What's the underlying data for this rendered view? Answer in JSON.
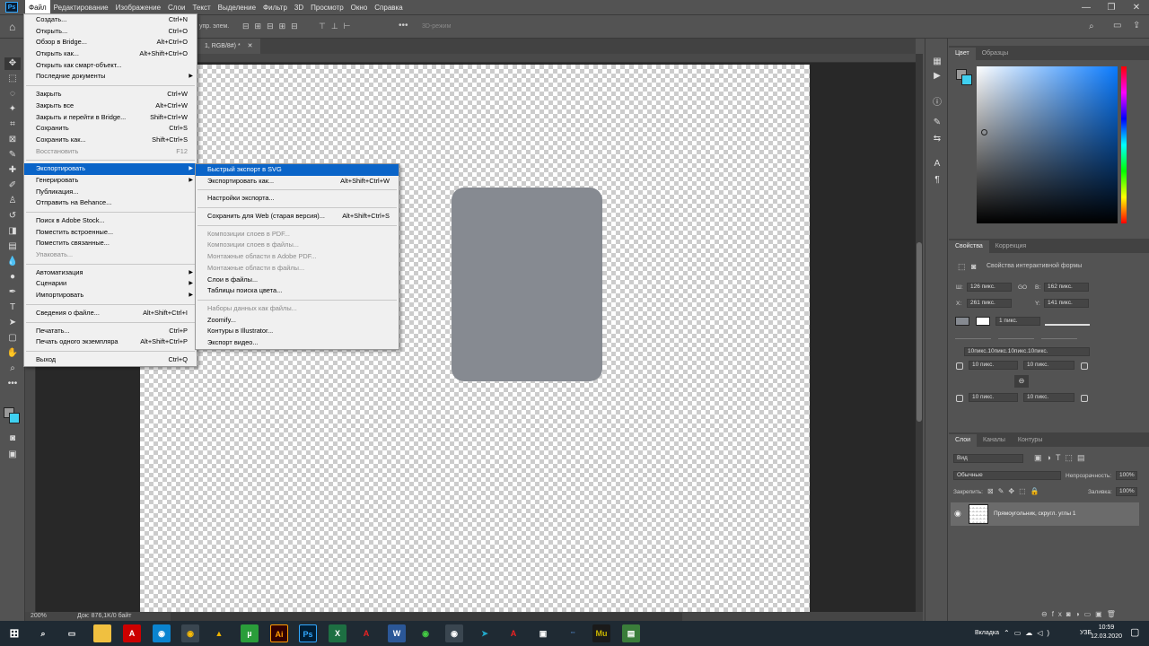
{
  "menubar": {
    "app_icon": "Ps",
    "items": [
      "Файл",
      "Редактирование",
      "Изображение",
      "Слои",
      "Текст",
      "Выделение",
      "Фильтр",
      "3D",
      "Просмотр",
      "Окно",
      "Справка"
    ]
  },
  "options": {
    "label": "упр. элем.",
    "mode3d": "3D-режим"
  },
  "document": {
    "tab_label": "1, RGB/8#) *",
    "zoom": "200%",
    "doc_info": "Док: 876,1K/0 байт"
  },
  "file_menu": {
    "groups": [
      [
        {
          "label": "Создать...",
          "shortcut": "Ctrl+N"
        },
        {
          "label": "Открыть...",
          "shortcut": "Ctrl+O"
        },
        {
          "label": "Обзор в Bridge...",
          "shortcut": "Alt+Ctrl+O"
        },
        {
          "label": "Открыть как...",
          "shortcut": "Alt+Shift+Ctrl+O"
        },
        {
          "label": "Открыть как смарт-объект...",
          "shortcut": ""
        },
        {
          "label": "Последние документы",
          "shortcut": "",
          "submenu": true
        }
      ],
      [
        {
          "label": "Закрыть",
          "shortcut": "Ctrl+W"
        },
        {
          "label": "Закрыть все",
          "shortcut": "Alt+Ctrl+W"
        },
        {
          "label": "Закрыть и перейти в Bridge...",
          "shortcut": "Shift+Ctrl+W"
        },
        {
          "label": "Сохранить",
          "shortcut": "Ctrl+S"
        },
        {
          "label": "Сохранить как...",
          "shortcut": "Shift+Ctrl+S"
        },
        {
          "label": "Восстановить",
          "shortcut": "F12",
          "disabled": true
        }
      ],
      [
        {
          "label": "Экспортировать",
          "shortcut": "",
          "submenu": true,
          "highlight": true
        },
        {
          "label": "Генерировать",
          "shortcut": "",
          "submenu": true
        },
        {
          "label": "Публикация...",
          "shortcut": ""
        },
        {
          "label": "Отправить на Behance...",
          "shortcut": ""
        }
      ],
      [
        {
          "label": "Поиск в Adobe Stock...",
          "shortcut": ""
        },
        {
          "label": "Поместить встроенные...",
          "shortcut": ""
        },
        {
          "label": "Поместить связанные...",
          "shortcut": ""
        },
        {
          "label": "Упаковать...",
          "shortcut": "",
          "disabled": true
        }
      ],
      [
        {
          "label": "Автоматизация",
          "shortcut": "",
          "submenu": true
        },
        {
          "label": "Сценарии",
          "shortcut": "",
          "submenu": true
        },
        {
          "label": "Импортировать",
          "shortcut": "",
          "submenu": true
        }
      ],
      [
        {
          "label": "Сведения о файле...",
          "shortcut": "Alt+Shift+Ctrl+I"
        }
      ],
      [
        {
          "label": "Печатать...",
          "shortcut": "Ctrl+P"
        },
        {
          "label": "Печать одного экземпляра",
          "shortcut": "Alt+Shift+Ctrl+P"
        }
      ],
      [
        {
          "label": "Выход",
          "shortcut": "Ctrl+Q"
        }
      ]
    ]
  },
  "export_menu": {
    "groups": [
      [
        {
          "label": "Быстрый экспорт в SVG",
          "shortcut": "",
          "highlight": true
        },
        {
          "label": "Экспортировать как...",
          "shortcut": "Alt+Shift+Ctrl+W"
        }
      ],
      [
        {
          "label": "Настройки экспорта...",
          "shortcut": ""
        }
      ],
      [
        {
          "label": "Сохранить для Web (старая версия)...",
          "shortcut": "Alt+Shift+Ctrl+S"
        }
      ],
      [
        {
          "label": "Композиции слоев в PDF...",
          "shortcut": "",
          "disabled": true
        },
        {
          "label": "Композиции слоев в файлы...",
          "shortcut": "",
          "disabled": true
        },
        {
          "label": "Монтажные области в Adobe PDF...",
          "shortcut": "",
          "disabled": true
        },
        {
          "label": "Монтажные области в файлы...",
          "shortcut": "",
          "disabled": true
        },
        {
          "label": "Слои в файлы...",
          "shortcut": ""
        },
        {
          "label": "Таблицы поиска цвета...",
          "shortcut": ""
        }
      ],
      [
        {
          "label": "Наборы данных как файлы...",
          "shortcut": "",
          "disabled": true
        },
        {
          "label": "Zoomify...",
          "shortcut": ""
        },
        {
          "label": "Контуры в Illustrator...",
          "shortcut": ""
        },
        {
          "label": "Экспорт видео...",
          "shortcut": ""
        }
      ]
    ]
  },
  "color_panel": {
    "tabs": [
      "Цвет",
      "Образцы"
    ],
    "foreground": "#9a9a9a",
    "background": "#3fd0f0"
  },
  "properties_panel": {
    "tabs": [
      "Свойства",
      "Коррекция"
    ],
    "title": "Свойства интерактивной формы",
    "w_label": "Ш:",
    "w_value": "126 пикс.",
    "link_label": "GO",
    "h_label": "В:",
    "h_value": "162 пикс.",
    "x_label": "X:",
    "x_value": "261 пикс.",
    "y_label": "Y:",
    "y_value": "141 пикс.",
    "stroke_width": "1 пикс.",
    "corners_combined": "10пикс.10пикс.10пикс.10пикс.",
    "corner_tl": "10 пикс.",
    "corner_tr": "10 пикс.",
    "corner_bl": "10 пикс.",
    "corner_br": "10 пикс."
  },
  "layers_panel": {
    "tabs": [
      "Слои",
      "Каналы",
      "Контуры"
    ],
    "filter": "Вид",
    "blend_mode": "Обычные",
    "opacity_label": "Непрозрачность:",
    "opacity": "100%",
    "lock_label": "Закрепить:",
    "fill_label": "Заливка:",
    "fill": "100%",
    "layers": [
      {
        "name": "Прямоугольник, скругл. углы 1"
      }
    ]
  },
  "taskbar": {
    "language": "УЗБ",
    "tray_label": "Вкладка",
    "time": "10:59",
    "date": "12.03.2020"
  }
}
